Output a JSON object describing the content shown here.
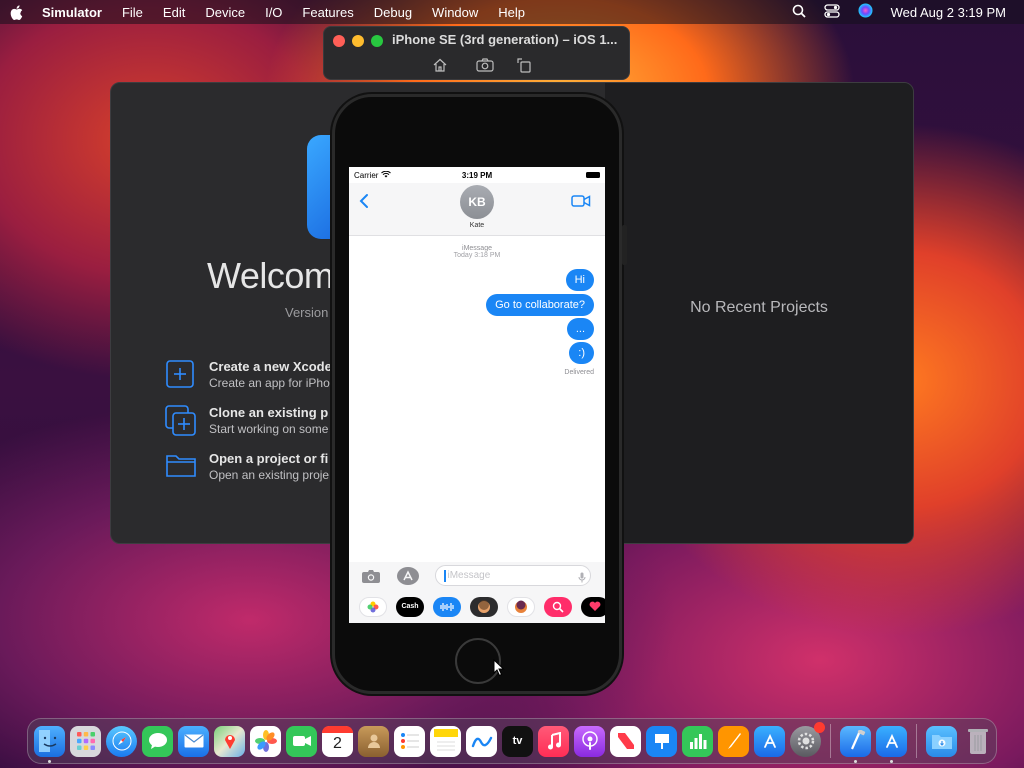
{
  "menubar": {
    "app_name": "Simulator",
    "items": [
      "File",
      "Edit",
      "Device",
      "I/O",
      "Features",
      "Debug",
      "Window",
      "Help"
    ],
    "clock": "Wed Aug 2  3:19 PM"
  },
  "xcode": {
    "welcome_title": "Welcom",
    "version_label": "Version",
    "no_recent": "No Recent Projects",
    "actions": [
      {
        "title": "Create a new Xcode",
        "subtitle": "Create an app for iPho"
      },
      {
        "title": "Clone an existing p",
        "subtitle": "Start working on some"
      },
      {
        "title": "Open a project or fi",
        "subtitle": "Open an existing proje"
      }
    ]
  },
  "simulator": {
    "title": "iPhone SE (3rd generation) – iOS 1..."
  },
  "phone": {
    "status": {
      "carrier": "Carrier",
      "time": "3:19 PM"
    },
    "contact": {
      "initials": "KB",
      "name": "Kate"
    },
    "thread": {
      "service": "iMessage",
      "timestamp": "Today 3:18 PM",
      "messages": [
        "Hi",
        "Go to collaborate?",
        "...",
        ":)"
      ],
      "delivered": "Delivered"
    },
    "input": {
      "placeholder": "iMessage"
    },
    "apps": {
      "cash_label": "Cash"
    }
  },
  "dock": {
    "calendar_day": "2",
    "tv_label": "tv"
  },
  "colors": {
    "imessage_blue": "#1a86f5",
    "xcode_bg": "#2b2b2d",
    "accent_blue": "#2f8cff"
  }
}
